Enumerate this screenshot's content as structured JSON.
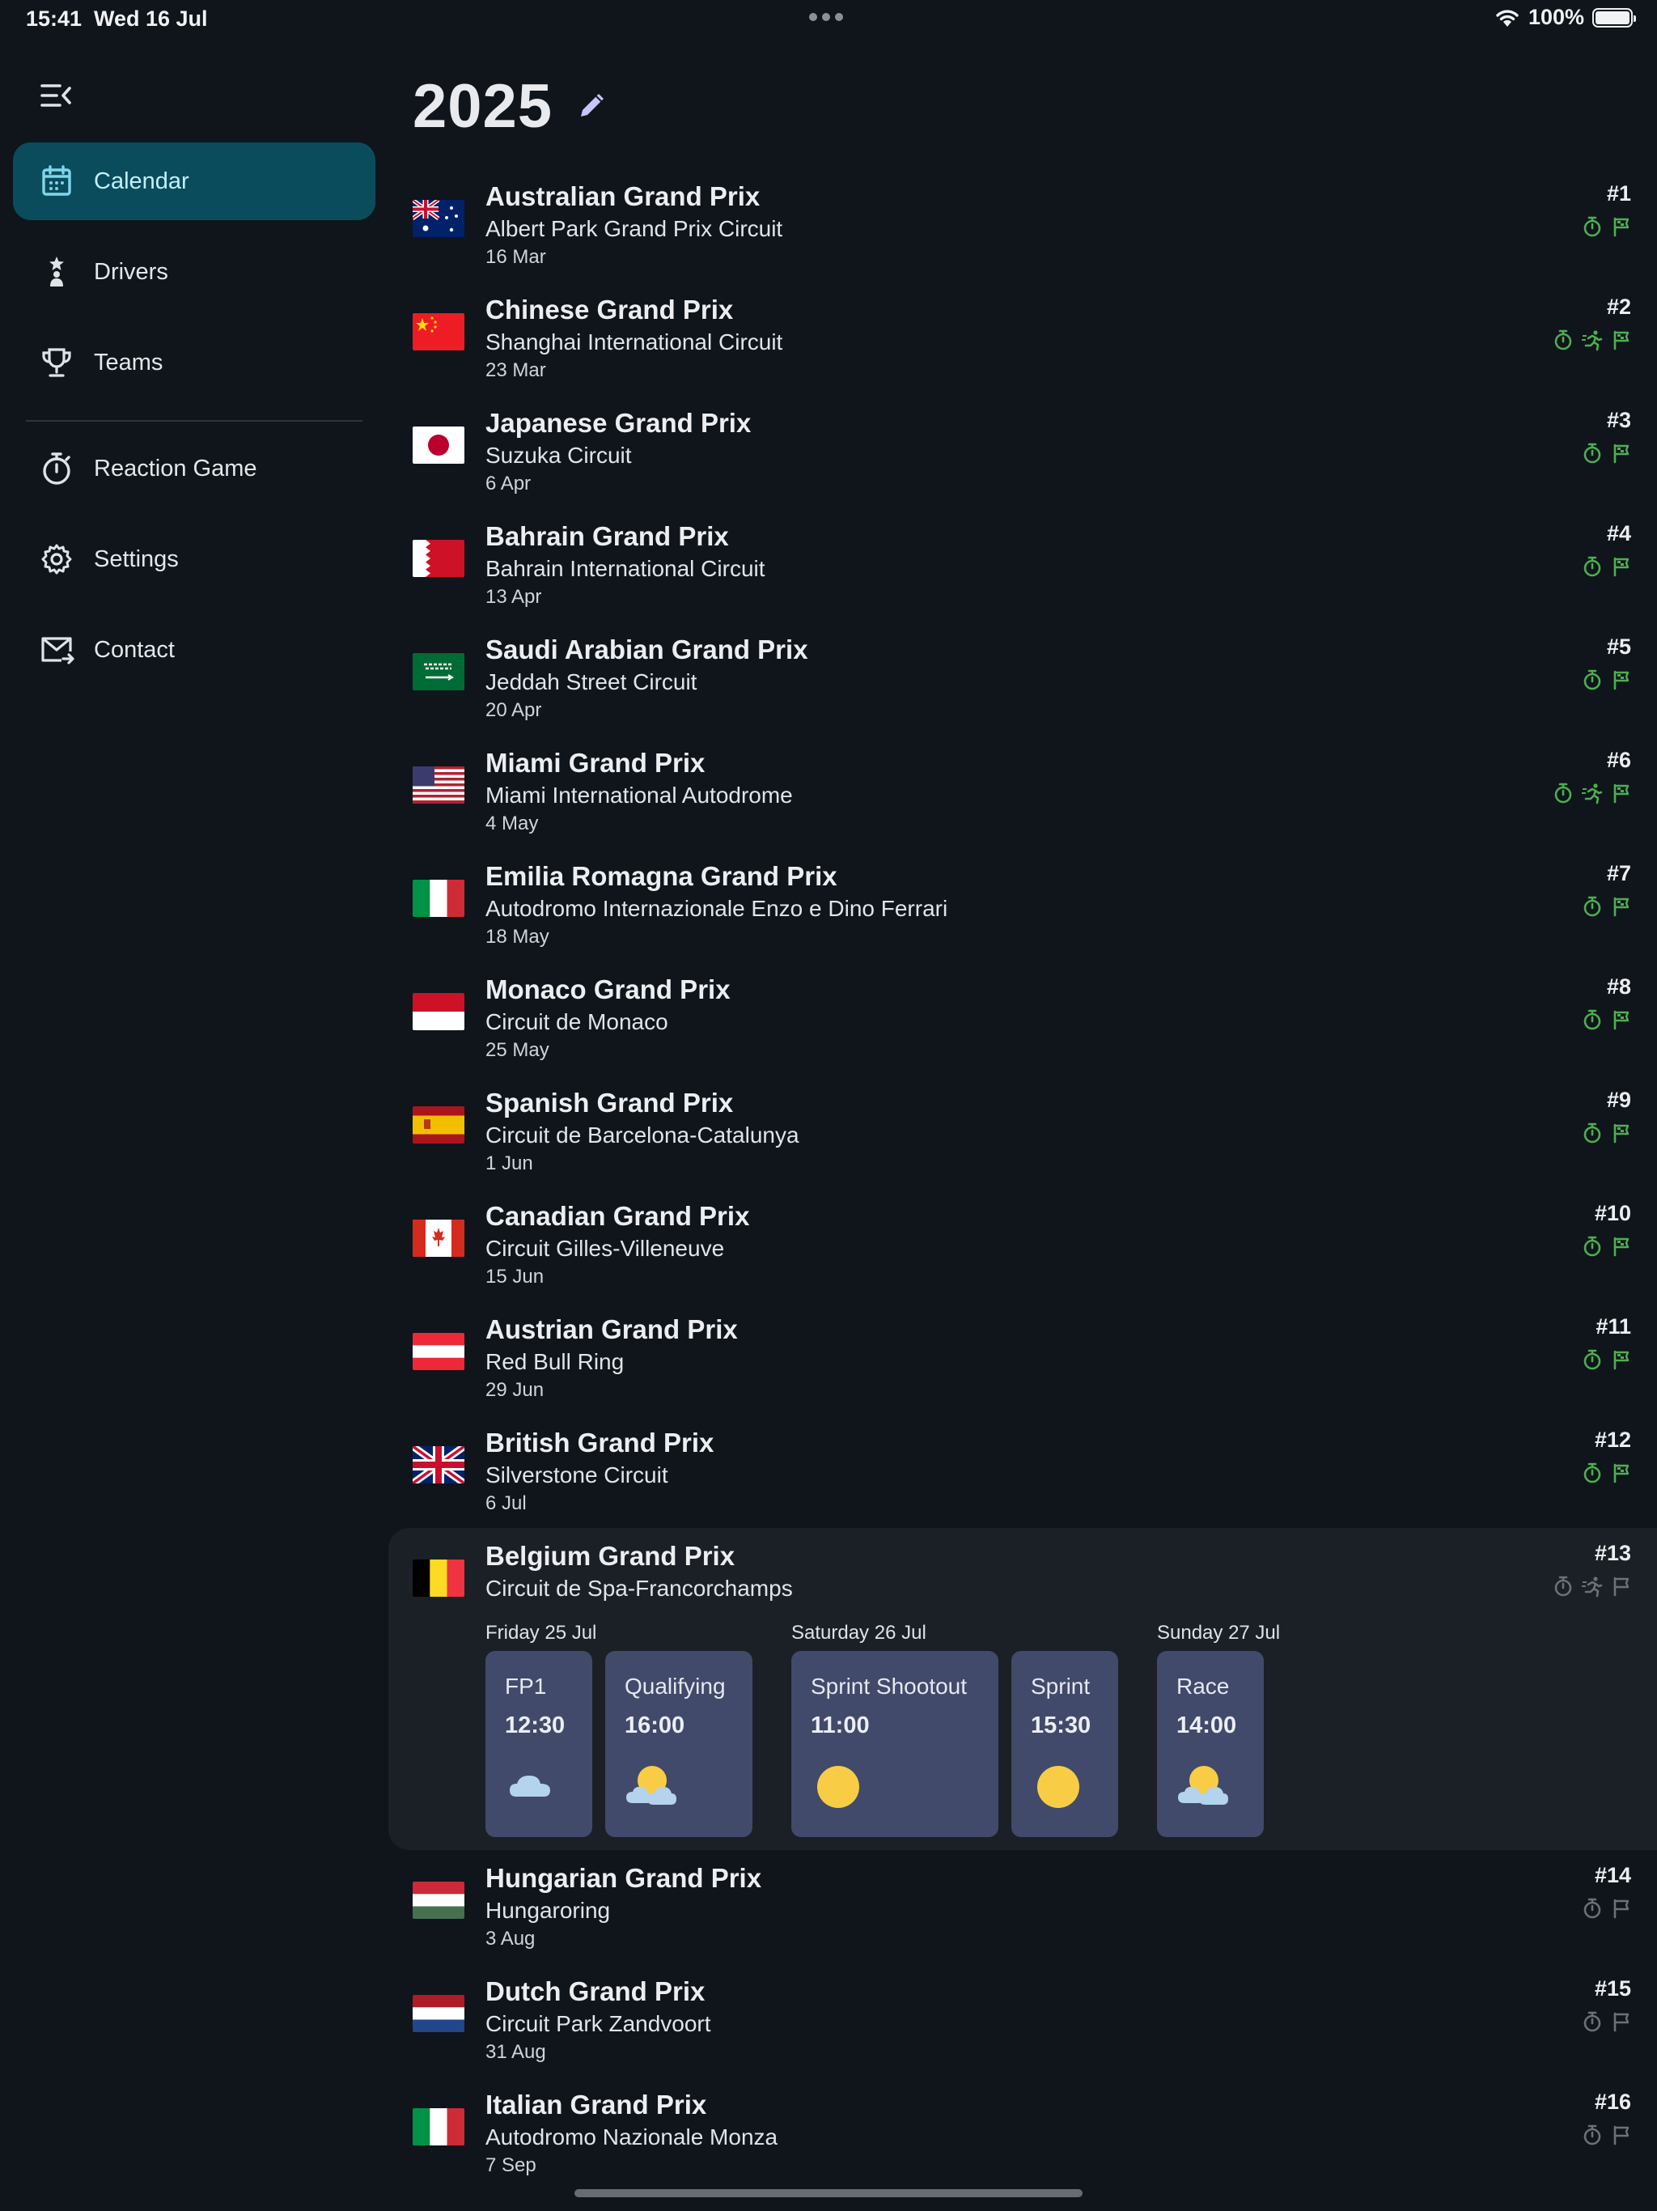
{
  "status_bar": {
    "time": "15:41",
    "date": "Wed 16 Jul",
    "battery": "100%"
  },
  "colors": {
    "accent": "#0b4c5c",
    "badge_active": "#4caf50",
    "badge_inactive": "#6b7178",
    "session_card": "#414a6a"
  },
  "sidebar": {
    "items": [
      {
        "label": "Calendar",
        "icon": "calendar-icon",
        "active": true
      },
      {
        "label": "Drivers",
        "icon": "driver-icon",
        "active": false
      },
      {
        "label": "Teams",
        "icon": "trophy-icon",
        "active": false
      },
      {
        "label": "Reaction Game",
        "icon": "stopwatch-icon",
        "active": false
      },
      {
        "label": "Settings",
        "icon": "gear-icon",
        "active": false
      },
      {
        "label": "Contact",
        "icon": "mail-icon",
        "active": false
      }
    ]
  },
  "header": {
    "title": "2025"
  },
  "races": [
    {
      "name": "Australian Grand Prix",
      "circuit": "Albert Park Grand Prix Circuit",
      "date": "16 Mar",
      "round": "#1",
      "flag": "australia",
      "sprint": false,
      "completed": true
    },
    {
      "name": "Chinese Grand Prix",
      "circuit": "Shanghai International Circuit",
      "date": "23 Mar",
      "round": "#2",
      "flag": "china",
      "sprint": true,
      "completed": true
    },
    {
      "name": "Japanese Grand Prix",
      "circuit": "Suzuka Circuit",
      "date": "6 Apr",
      "round": "#3",
      "flag": "japan",
      "sprint": false,
      "completed": true
    },
    {
      "name": "Bahrain Grand Prix",
      "circuit": "Bahrain International Circuit",
      "date": "13 Apr",
      "round": "#4",
      "flag": "bahrain",
      "sprint": false,
      "completed": true
    },
    {
      "name": "Saudi Arabian Grand Prix",
      "circuit": "Jeddah Street Circuit",
      "date": "20 Apr",
      "round": "#5",
      "flag": "saudi",
      "sprint": false,
      "completed": true
    },
    {
      "name": "Miami Grand Prix",
      "circuit": "Miami International Autodrome",
      "date": "4 May",
      "round": "#6",
      "flag": "usa",
      "sprint": true,
      "completed": true
    },
    {
      "name": "Emilia Romagna Grand Prix",
      "circuit": "Autodromo Internazionale Enzo e Dino Ferrari",
      "date": "18 May",
      "round": "#7",
      "flag": "italy",
      "sprint": false,
      "completed": true
    },
    {
      "name": "Monaco Grand Prix",
      "circuit": "Circuit de Monaco",
      "date": "25 May",
      "round": "#8",
      "flag": "monaco",
      "sprint": false,
      "completed": true
    },
    {
      "name": "Spanish Grand Prix",
      "circuit": "Circuit de Barcelona-Catalunya",
      "date": "1 Jun",
      "round": "#9",
      "flag": "spain",
      "sprint": false,
      "completed": true
    },
    {
      "name": "Canadian Grand Prix",
      "circuit": "Circuit Gilles-Villeneuve",
      "date": "15 Jun",
      "round": "#10",
      "flag": "canada",
      "sprint": false,
      "completed": true
    },
    {
      "name": "Austrian Grand Prix",
      "circuit": "Red Bull Ring",
      "date": "29 Jun",
      "round": "#11",
      "flag": "austria",
      "sprint": false,
      "completed": true
    },
    {
      "name": "British Grand Prix",
      "circuit": "Silverstone Circuit",
      "date": "6 Jul",
      "round": "#12",
      "flag": "uk",
      "sprint": false,
      "completed": true
    },
    {
      "name": "Belgium Grand Prix",
      "circuit": "Circuit de Spa-Francorchamps",
      "date": "",
      "round": "#13",
      "flag": "belgium",
      "sprint": true,
      "completed": false,
      "expanded": true
    },
    {
      "name": "Hungarian Grand Prix",
      "circuit": "Hungaroring",
      "date": "3 Aug",
      "round": "#14",
      "flag": "hungary",
      "sprint": false,
      "completed": false
    },
    {
      "name": "Dutch Grand Prix",
      "circuit": "Circuit Park Zandvoort",
      "date": "31 Aug",
      "round": "#15",
      "flag": "netherlands",
      "sprint": false,
      "completed": false
    },
    {
      "name": "Italian Grand Prix",
      "circuit": "Autodromo Nazionale Monza",
      "date": "7 Sep",
      "round": "#16",
      "flag": "italy",
      "sprint": false,
      "completed": false
    }
  ],
  "weekend": {
    "days": [
      "Friday 25 Jul",
      "Saturday 26 Jul",
      "Sunday 27 Jul"
    ],
    "sessions": [
      {
        "name": "FP1",
        "time": "12:30",
        "weather": "cloud-icon"
      },
      {
        "name": "Qualifying",
        "time": "16:00",
        "weather": "partly-cloudy-icon"
      },
      {
        "name": "Sprint Shootout",
        "time": "11:00",
        "weather": "sun-icon"
      },
      {
        "name": "Sprint",
        "time": "15:30",
        "weather": "sun-icon"
      },
      {
        "name": "Race",
        "time": "14:00",
        "weather": "partly-cloudy-icon"
      }
    ]
  }
}
